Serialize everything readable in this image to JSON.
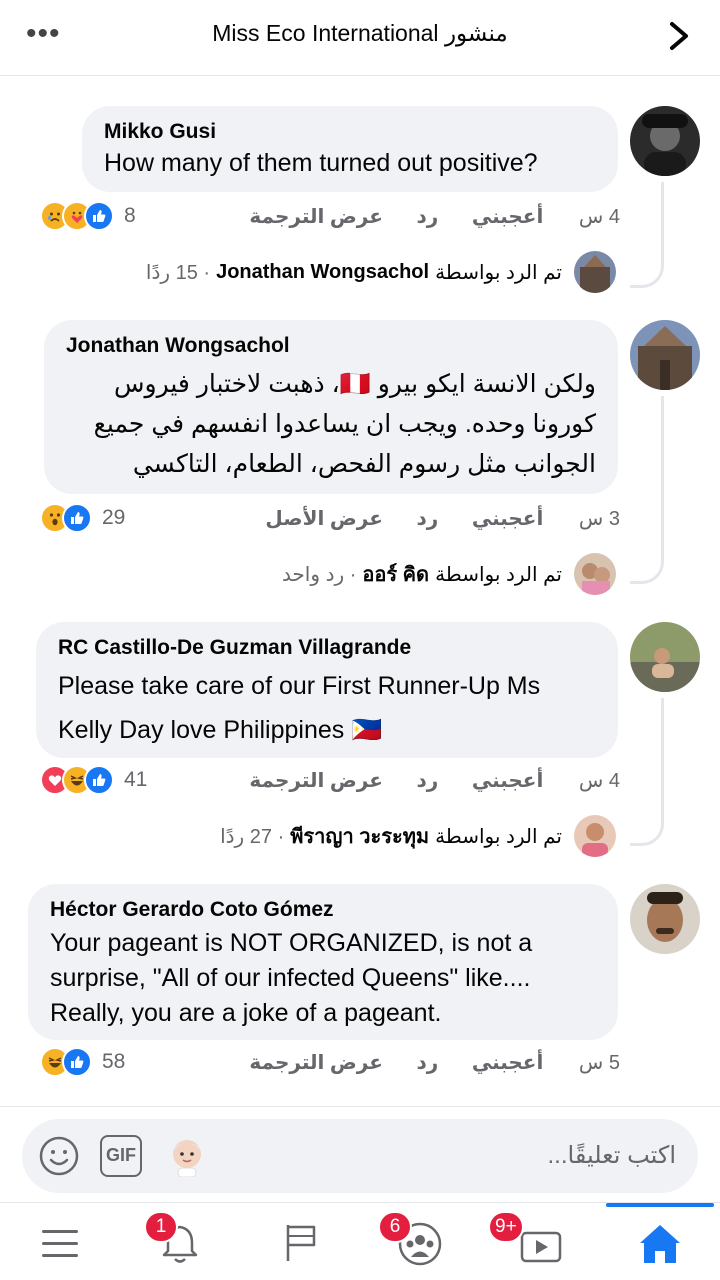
{
  "header": {
    "title": "Miss Eco International منشور",
    "more_icon": "more-dots-icon",
    "back_icon": "chevron-right-icon"
  },
  "comments": [
    {
      "author": "Mikko Gusi",
      "text": "How many of them turned out positive?",
      "time": "4 س",
      "like": "أعجبني",
      "reply": "رد",
      "view": "عرض الترجمة",
      "reaction_count": "8",
      "reactions": [
        "sad",
        "care",
        "like"
      ],
      "reply_summary": {
        "prefix": "تم الرد بواسطة",
        "name": "Jonathan Wongsachol",
        "count": "· 15 ردًا"
      }
    },
    {
      "author": "Jonathan Wongsachol",
      "text": "ولكن الانسة ايكو بيرو 🇵🇪، ذهبت لاختبار فيروس كورونا وحده. ويجب ان يساعدوا انفسهم في جميع الجوانب مثل رسوم الفحص، الطعام، التاكسي",
      "time": "3 س",
      "like": "أعجبني",
      "reply": "رد",
      "view": "عرض الأصل",
      "reaction_count": "29",
      "reactions": [
        "wow",
        "like"
      ],
      "reply_summary": {
        "prefix": "تم الرد بواسطة",
        "name": "ออร์ คิด",
        "count": "· رد واحد"
      }
    },
    {
      "author": "RC Castillo-De Guzman Villagrande",
      "text": "Please take care of our First Runner-Up Ms Kelly Day love Philippines 🇵🇭",
      "time": "4 س",
      "like": "أعجبني",
      "reply": "رد",
      "view": "عرض الترجمة",
      "reaction_count": "41",
      "reactions": [
        "love",
        "haha",
        "like"
      ],
      "reply_summary": {
        "prefix": "تم الرد بواسطة",
        "name": "พีราญา วะระทุม",
        "count": "· 27 ردًا"
      }
    },
    {
      "author": "Héctor Gerardo Coto Gómez",
      "text": "Your pageant is NOT ORGANIZED, is not a surprise, \"All of our infected Queens\" like.... Really, you are a joke of a pageant.",
      "time": "5 س",
      "like": "أعجبني",
      "reply": "رد",
      "view": "عرض الترجمة",
      "reaction_count": "58",
      "reactions": [
        "haha",
        "like"
      ]
    }
  ],
  "composer": {
    "placeholder": "اكتب تعليقًا...",
    "emoji_icon": "emoji-icon",
    "gif_label": "GIF",
    "avatar_icon": "avatar-sticker-icon"
  },
  "nav": {
    "notifications_badge": "1",
    "groups_badge": "6",
    "watch_badge": "9+"
  },
  "colors": {
    "accent": "#1877f2",
    "bubble": "#f0f2f5",
    "secondary_text": "#65676b",
    "badge": "#e41e3f"
  }
}
